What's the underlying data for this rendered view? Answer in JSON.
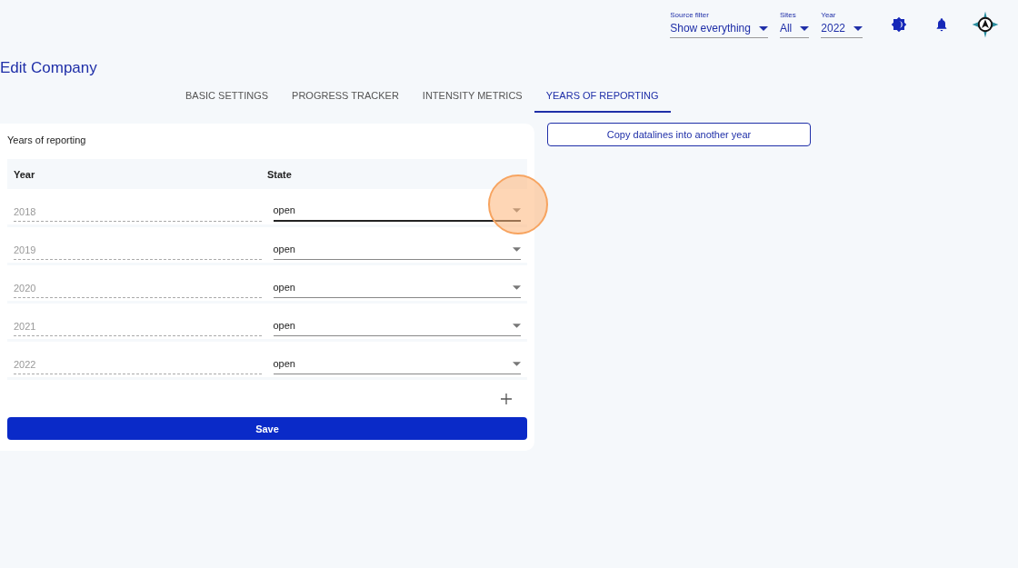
{
  "top_bar": {
    "filters": [
      {
        "label": "Source filter",
        "value": "Show everything"
      },
      {
        "label": "Sites",
        "value": "All"
      },
      {
        "label": "Year",
        "value": "2022"
      }
    ]
  },
  "title": "Edit Company",
  "tabs": [
    {
      "label": "BASIC SETTINGS",
      "selected": false
    },
    {
      "label": "PROGRESS TRACKER",
      "selected": false
    },
    {
      "label": "INTENSITY METRICS",
      "selected": false
    },
    {
      "label": "YEARS OF REPORTING",
      "selected": true
    }
  ],
  "card": {
    "title": "Years of reporting",
    "columns": [
      "Year",
      "State"
    ],
    "rows": [
      {
        "year": "2018",
        "state": "open",
        "focused": true
      },
      {
        "year": "2019",
        "state": "open",
        "focused": false
      },
      {
        "year": "2020",
        "state": "open",
        "focused": false
      },
      {
        "year": "2021",
        "state": "open",
        "focused": false
      },
      {
        "year": "2022",
        "state": "open",
        "focused": false
      }
    ],
    "save": "Save"
  },
  "copy_button": "Copy datalines into another year"
}
